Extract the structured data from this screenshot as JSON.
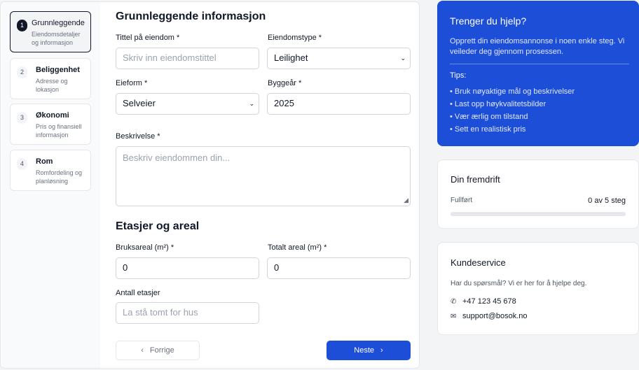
{
  "steps": [
    {
      "num": "1",
      "title": "Grunnleggende",
      "sub": "Eiendomsdetaljer og informasjon",
      "active": true
    },
    {
      "num": "2",
      "title": "Beliggenhet",
      "sub": "Adresse og lokasjon",
      "active": false
    },
    {
      "num": "3",
      "title": "Økonomi",
      "sub": "Pris og finansiell informasjon",
      "active": false
    },
    {
      "num": "4",
      "title": "Rom",
      "sub": "Romfordeling og planløsning",
      "active": false
    }
  ],
  "section1": {
    "heading": "Grunnleggende informasjon",
    "title_label": "Tittel på eiendom *",
    "title_placeholder": "Skriv inn eiendomstittel",
    "type_label": "Eiendomstype *",
    "type_value": "Leilighet",
    "ownership_label": "Eieform *",
    "ownership_value": "Selveier",
    "year_label": "Byggeår *",
    "year_value": "2025",
    "desc_label": "Beskrivelse *",
    "desc_placeholder": "Beskriv eiendommen din..."
  },
  "section2": {
    "heading": "Etasjer og areal",
    "usable_label": "Bruksareal (m²) *",
    "usable_value": "0",
    "total_label": "Totalt areal (m²) *",
    "total_value": "0",
    "floors_label": "Antall etasjer",
    "floors_placeholder": "La stå tomt for hus"
  },
  "nav": {
    "prev": "Forrige",
    "next": "Neste"
  },
  "help": {
    "title": "Trenger du hjelp?",
    "desc": "Opprett din eiendomsannonse i noen enkle steg. Vi veileder deg gjennom prosessen.",
    "tips_heading": "Tips:",
    "tips": [
      "• Bruk nøyaktige mål og beskrivelser",
      "• Last opp høykvalitetsbilder",
      "• Vær ærlig om tilstand",
      "• Sett en realistisk pris"
    ]
  },
  "progress": {
    "title": "Din fremdrift",
    "label": "Fullført",
    "value_text": "0 av 5 steg",
    "fraction": 0
  },
  "support": {
    "title": "Kundeservice",
    "desc": "Har du spørsmål? Vi er her for å hjelpe deg.",
    "phone": "+47 123 45 678",
    "email": "support@bosok.no"
  },
  "colors": {
    "accent": "#1d4ed8"
  }
}
